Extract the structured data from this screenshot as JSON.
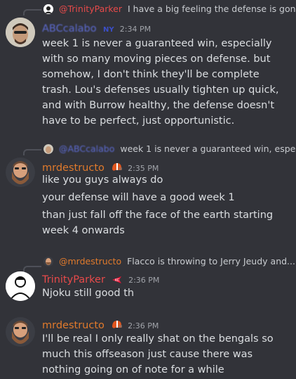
{
  "colors": {
    "background": "#323339",
    "text": "#dbdee1",
    "muted": "#a0a3a9",
    "name_red": "#e74a4a",
    "name_orange": "#e07a2c",
    "name_blue": "#5d6bd1"
  },
  "messages": [
    {
      "reply": {
        "author": "@TrinityParker",
        "text": "I have a big feeling the defense is gon..."
      },
      "author": "ABCcalabo",
      "author_badge": "NYG",
      "time": "2:34 PM",
      "lines": [
        "week 1 is never a guaranteed win, especially with so many moving pieces on defense. but somehow, I don't think they'll be complete trash. Lou's defenses usually tighten up quick, and with Burrow healthy, the defense doesn't have to be perfect, just opportunistic."
      ]
    },
    {
      "reply": {
        "author": "@ABCcalabo",
        "text": "week 1 is never a guaranteed win, espe..."
      },
      "author": "mrdestructo",
      "author_badge": "browns-helmet-icon",
      "time": "2:35 PM",
      "lines": [
        "like you guys always do",
        "your defense will have a good week 1",
        "than just fall off the face of the earth starting week 4 onwards"
      ]
    },
    {
      "reply": {
        "author": "@mrdestructo",
        "text": "Flacco is throwing to Jerry Jeudy and..."
      },
      "author": "TrinityParker",
      "author_badge": "chiefs-arrowhead-icon",
      "time": "2:36 PM",
      "lines": [
        "Njoku still good th"
      ]
    },
    {
      "author": "mrdestructo",
      "author_badge": "browns-helmet-icon",
      "time": "2:36 PM",
      "lines": [
        "I'll be real I only really shat on the bengals so much this offseason just cause there was nothing going on of note for a while"
      ]
    }
  ]
}
